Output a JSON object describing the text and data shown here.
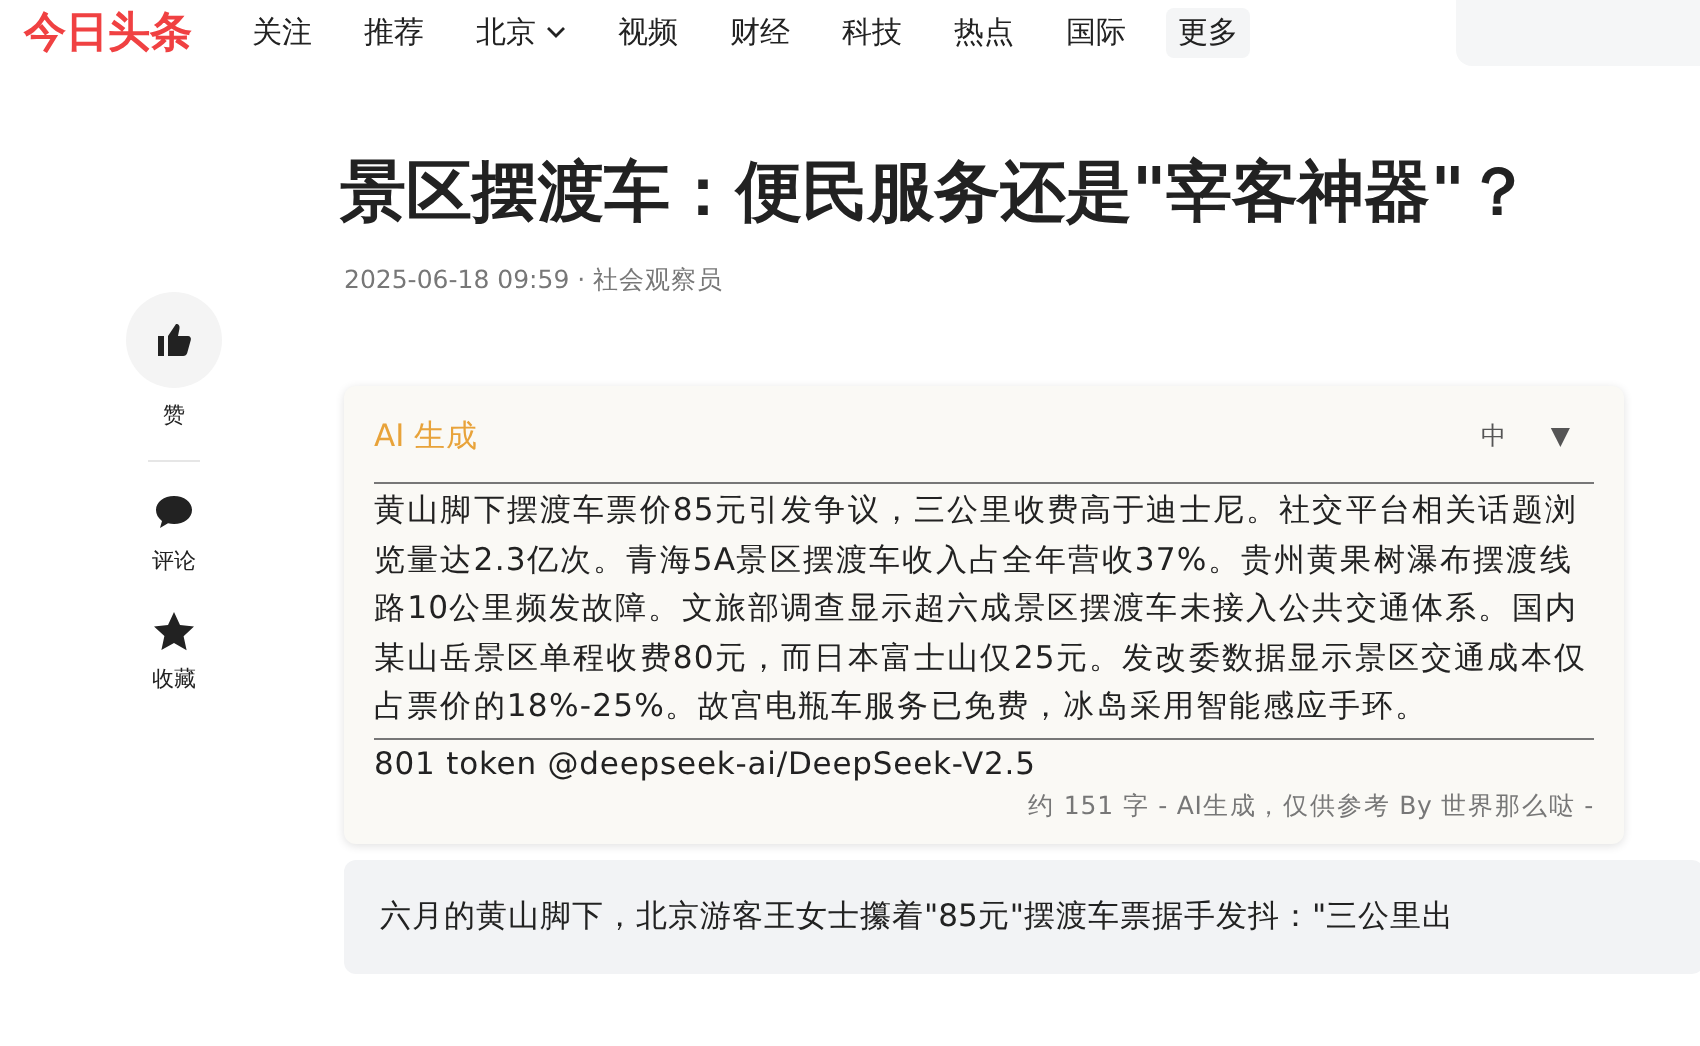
{
  "logo": "今日头条",
  "nav": [
    {
      "label": "关注",
      "kind": "link",
      "dropdown": false
    },
    {
      "label": "推荐",
      "kind": "link",
      "dropdown": false
    },
    {
      "label": "北京",
      "kind": "link",
      "dropdown": true
    },
    {
      "label": "视频",
      "kind": "link",
      "dropdown": false
    },
    {
      "label": "财经",
      "kind": "link",
      "dropdown": false
    },
    {
      "label": "科技",
      "kind": "link",
      "dropdown": false
    },
    {
      "label": "热点",
      "kind": "link",
      "dropdown": false
    },
    {
      "label": "国际",
      "kind": "link",
      "dropdown": false
    },
    {
      "label": "更多",
      "kind": "more",
      "dropdown": false
    }
  ],
  "actions": [
    {
      "kind": "like",
      "label": "赞"
    },
    {
      "kind": "comment",
      "label": "评论"
    },
    {
      "kind": "favorite",
      "label": "收藏"
    }
  ],
  "article": {
    "title": "景区摆渡车：便民服务还是\"宰客神器\"？",
    "meta": "2025-06-18 09:59 · 社会观察员",
    "ai_summary": {
      "heading": "AI 生成",
      "size": "中",
      "toggle": "▼",
      "text": "黄山脚下摆渡车票价85元引发争议，三公里收费高于迪士尼。社交平台相关话题浏览量达2.3亿次。青海5A景区摆渡车收入占全年营收37%。贵州黄果树瀑布摆渡线路10公里频发故障。文旅部调查显示超六成景区摆渡车未接入公共交通体系。国内某山岳景区单程收费80元，而日本富士山仅25元。发改委数据显示景区交通成本仅占票价的18%-25%。故宫电瓶车服务已免费，冰岛采用智能感应手环。",
      "model": "801 token @deepseek-ai/DeepSeek-V2.5",
      "footer": "约 151 字 - AI生成，仅供参考 By 世界那么哒 -"
    },
    "lead": "六月的黄山脚下，北京游客王女士攥着\"85元\"摆渡车票据手发抖：\"三公里出"
  }
}
